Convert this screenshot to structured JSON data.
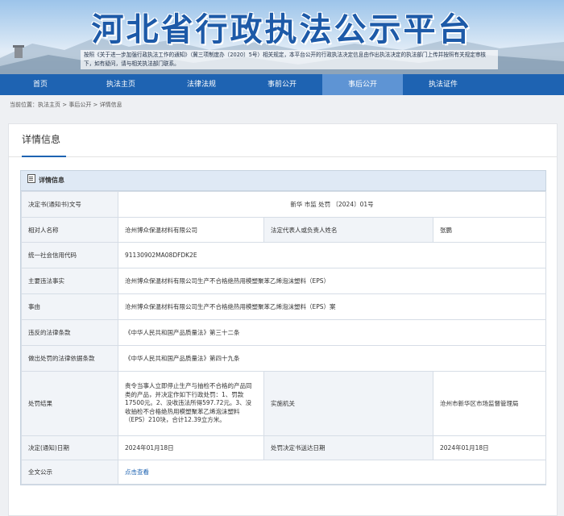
{
  "header": {
    "title": "河北省行政执法公示平台",
    "notice": "按照《关于进一步加强行政执法工作的通知》（冀三项制度办〔2020〕5号）相关规定，本平台公开的行政执法决定信息由作出执法决定的执法部门上传并按照有关规定审核下，如有疑问，请与相关执法部门联系。"
  },
  "nav": [
    "首页",
    "执法主页",
    "法律法规",
    "事前公开",
    "事后公开",
    "执法证件"
  ],
  "breadcrumb": {
    "prefix": "当前位置：",
    "items": [
      "执法主页",
      "事后公开",
      "详情信息"
    ],
    "sep": " > "
  },
  "panel": {
    "title": "详情信息",
    "card_title": "详情信息"
  },
  "details": {
    "doc_no_label": "决定书(通知书)文号",
    "doc_no": "新华 市监 处罚 〔2024〕01号",
    "party_label": "相对人名称",
    "party": "沧州博众保温材料有限公司",
    "rep_label": "法定代表人或负责人姓名",
    "rep": "张鹏",
    "credit_label": "统一社会信用代码",
    "credit": "91130902MA08DFDK2E",
    "facts_label": "主要违法事实",
    "facts": "沧州博众保温材料有限公司生产不合格绝热用模塑聚苯乙烯泡沫塑料（EPS）",
    "cause_label": "事由",
    "cause": "沧州博众保温材料有限公司生产不合格绝热用模塑聚苯乙烯泡沫塑料（EPS）案",
    "law_label": "违反的法律条款",
    "law": "《中华人民共和国产品质量法》第三十二条",
    "basis_label": "做出处罚的法律依据条款",
    "basis": "《中华人民共和国产品质量法》第四十九条",
    "result_label": "处罚结果",
    "result": "责令当事人立即停止生产与抽检不合格的产品同类的产品，并决定作如下行政处罚：1、罚款17500元。2、没收违法所得597.72元。3、没收抽检不合格绝热用模塑聚苯乙烯泡沫塑料（EPS）210块，合计12.39立方米。",
    "org_label": "实施机关",
    "org": "沧州市新华区市场监督管理局",
    "date_label": "决定(通知)日期",
    "date": "2024年01月18日",
    "deliver_label": "处罚决定书送达日期",
    "deliver_date": "2024年01月18日",
    "fulltext_label": "全文公示",
    "fulltext_link": "点击查看"
  }
}
